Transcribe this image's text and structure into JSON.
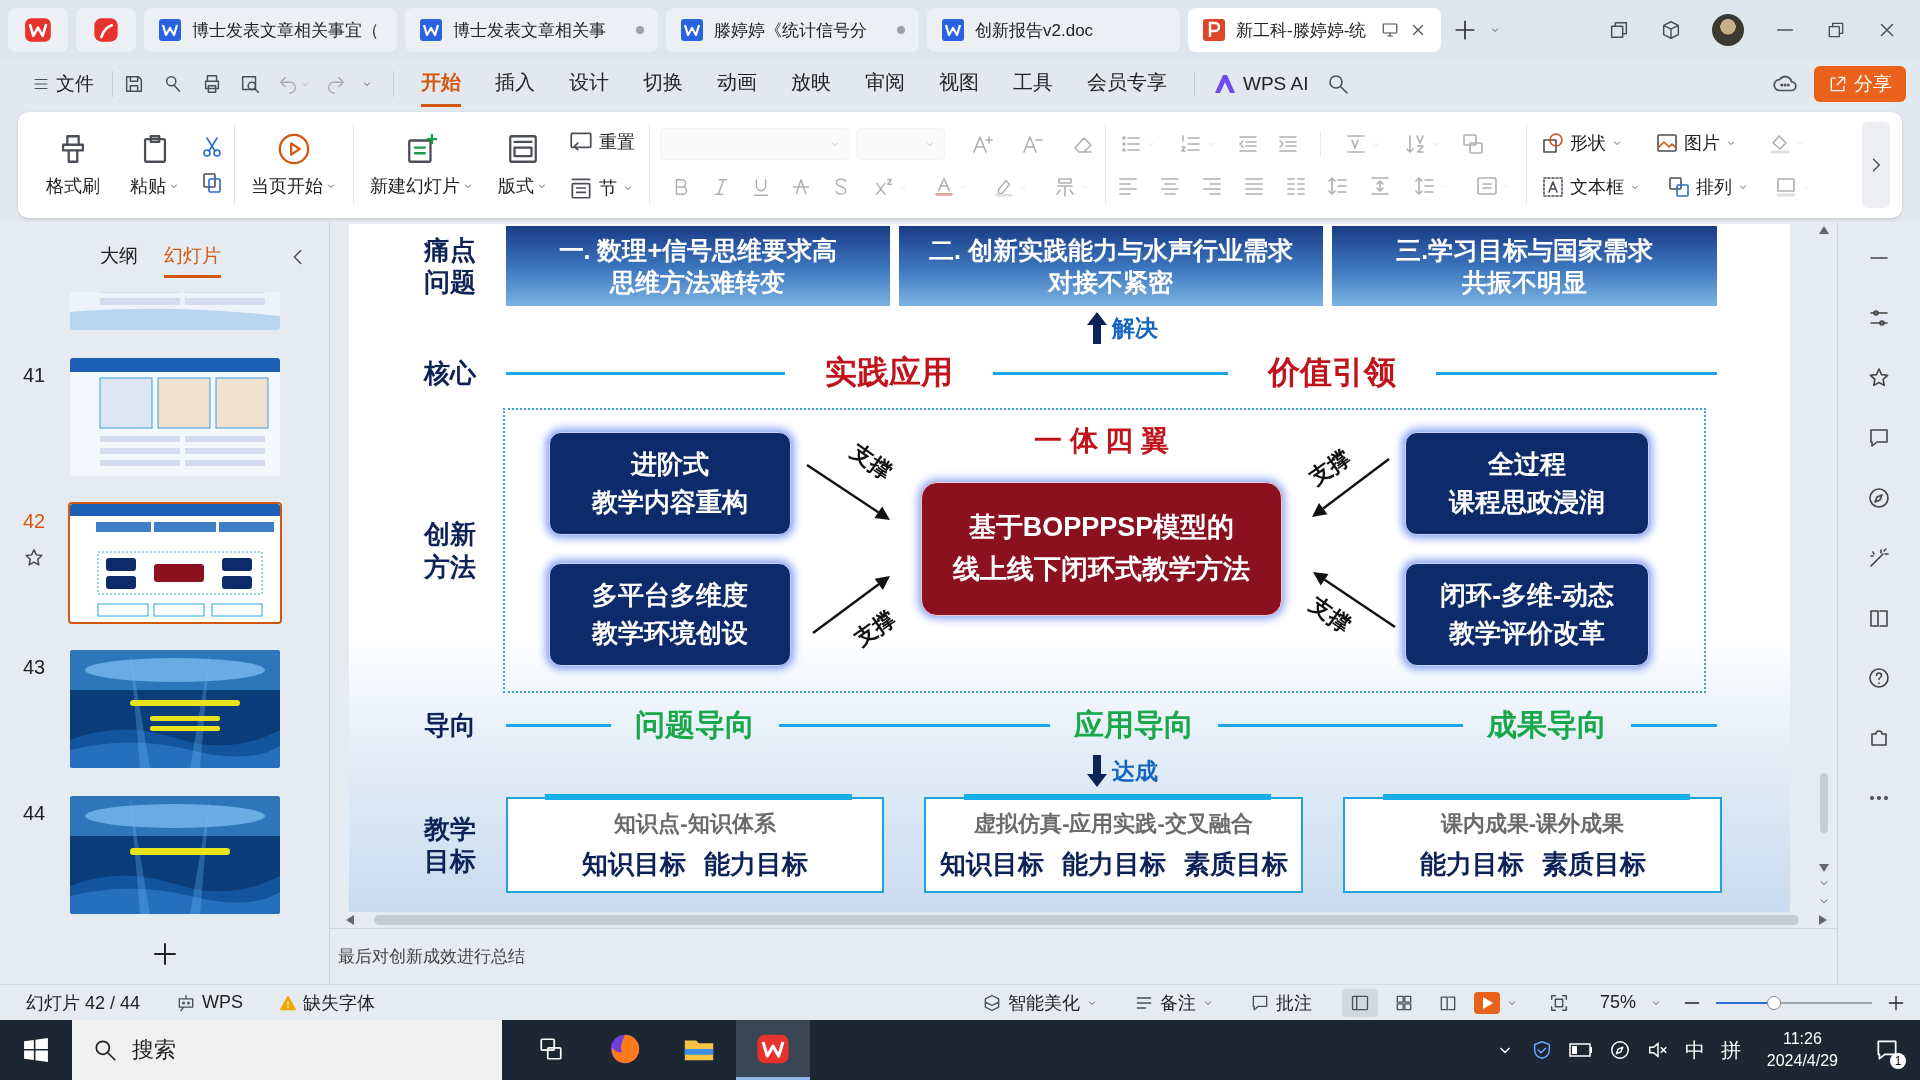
{
  "tabs": [
    {
      "kind": "home",
      "selected": false
    },
    {
      "kind": "pdf",
      "selected": false
    },
    {
      "kind": "writer",
      "title": "博士发表文章相关事宜（",
      "unsaved": false,
      "selected": false
    },
    {
      "kind": "writer",
      "title": "博士发表文章相关事",
      "unsaved": true,
      "selected": false
    },
    {
      "kind": "writer",
      "title": "滕婷婷《统计信号分",
      "unsaved": true,
      "selected": false
    },
    {
      "kind": "writer",
      "title": "创新报告v2.doc",
      "unsaved": false,
      "selected": false
    },
    {
      "kind": "presentation",
      "title": "新工科-滕婷婷-统",
      "selected": true
    }
  ],
  "menu": {
    "file": "文件",
    "tabs": [
      {
        "label": "开始",
        "selected": true
      },
      {
        "label": "插入",
        "selected": false
      },
      {
        "label": "设计",
        "selected": false
      },
      {
        "label": "切换",
        "selected": false
      },
      {
        "label": "动画",
        "selected": false
      },
      {
        "label": "放映",
        "selected": false
      },
      {
        "label": "审阅",
        "selected": false
      },
      {
        "label": "视图",
        "selected": false
      },
      {
        "label": "工具",
        "selected": false
      },
      {
        "label": "会员专享",
        "selected": false
      }
    ],
    "ai": "WPS AI",
    "share": "分享"
  },
  "ribbon": {
    "format_painter": "格式刷",
    "paste": "粘贴",
    "from_current": "当页开始",
    "new_slide": "新建幻灯片",
    "layout": "版式",
    "reset": "重置",
    "section": "节",
    "shape": "形状",
    "picture": "图片",
    "text_box": "文本框",
    "arrange": "排列"
  },
  "panel": {
    "tabs": [
      {
        "label": "大纲",
        "selected": false
      },
      {
        "label": "幻灯片",
        "selected": true
      }
    ],
    "slides": [
      {
        "selected": false
      },
      {
        "number": "41",
        "selected": false
      },
      {
        "number": "42",
        "selected": true
      },
      {
        "number": "43",
        "selected": false
      },
      {
        "number": "44",
        "selected": false
      }
    ]
  },
  "slide": {
    "pain_points": {
      "label": [
        "痛点",
        "问题"
      ],
      "items": [
        {
          "lines": [
            "一. 数理+信号思维要求高",
            "思维方法难转变"
          ]
        },
        {
          "lines": [
            "二. 创新实践能力与水声行业需求",
            "对接不紧密"
          ]
        },
        {
          "lines": [
            "三.学习目标与国家需求",
            "共振不明显"
          ]
        }
      ]
    },
    "solve": "解决",
    "core": {
      "label": [
        "核心"
      ],
      "items": [
        "实践应用",
        "价值引领"
      ]
    },
    "method": {
      "label": [
        "创新",
        "方法"
      ],
      "title": "一 体 四 翼",
      "center": [
        "基于BOPPPSP模型的",
        "线上线下闭环式教学方法"
      ],
      "wings": [
        {
          "lines": [
            "进阶式",
            "教学内容重构"
          ],
          "support": "支撑"
        },
        {
          "lines": [
            "全过程",
            "课程思政浸润"
          ],
          "support": "支撑"
        },
        {
          "lines": [
            "多平台多维度",
            "教学环境创设"
          ],
          "support": "支撑"
        },
        {
          "lines": [
            "闭环-多维-动态",
            "教学评价改革"
          ],
          "support": "支撑"
        }
      ]
    },
    "orientation": {
      "label": [
        "导向"
      ],
      "items": [
        "问题导向",
        "应用导向",
        "成果导向"
      ]
    },
    "achieve": "达成",
    "goals": {
      "label": [
        "教学",
        "目标"
      ],
      "items": [
        {
          "subtitle": "知识点-知识体系",
          "targets": [
            "知识目标",
            "能力目标"
          ]
        },
        {
          "subtitle": "虚拟仿真-应用实践-交叉融合",
          "targets": [
            "知识目标",
            "能力目标",
            "素质目标"
          ]
        },
        {
          "subtitle": "课内成果-课外成果",
          "targets": [
            "能力目标",
            "素质目标"
          ]
        }
      ]
    }
  },
  "notes": "最后对创新成效进行总结",
  "status": {
    "slide": "幻灯片 42 / 44",
    "wps": "WPS",
    "missing_font": "缺失字体",
    "beautify": "智能美化",
    "notes": "备注",
    "comments": "批注",
    "views": [
      {
        "selected": true
      },
      {
        "selected": false
      },
      {
        "selected": false
      }
    ],
    "zoom": "75%",
    "zoom_slider": {
      "level": 0.37
    }
  },
  "taskbar": {
    "search": "搜索",
    "apps": [
      {
        "kind": "taskview",
        "selected": false
      },
      {
        "kind": "browser",
        "selected": false
      },
      {
        "kind": "files",
        "selected": false
      },
      {
        "kind": "wps",
        "selected": true
      }
    ],
    "ime": "中",
    "ime_mode": "拼",
    "time": "11:26",
    "date": "2024/4/29",
    "notifications": "1"
  }
}
